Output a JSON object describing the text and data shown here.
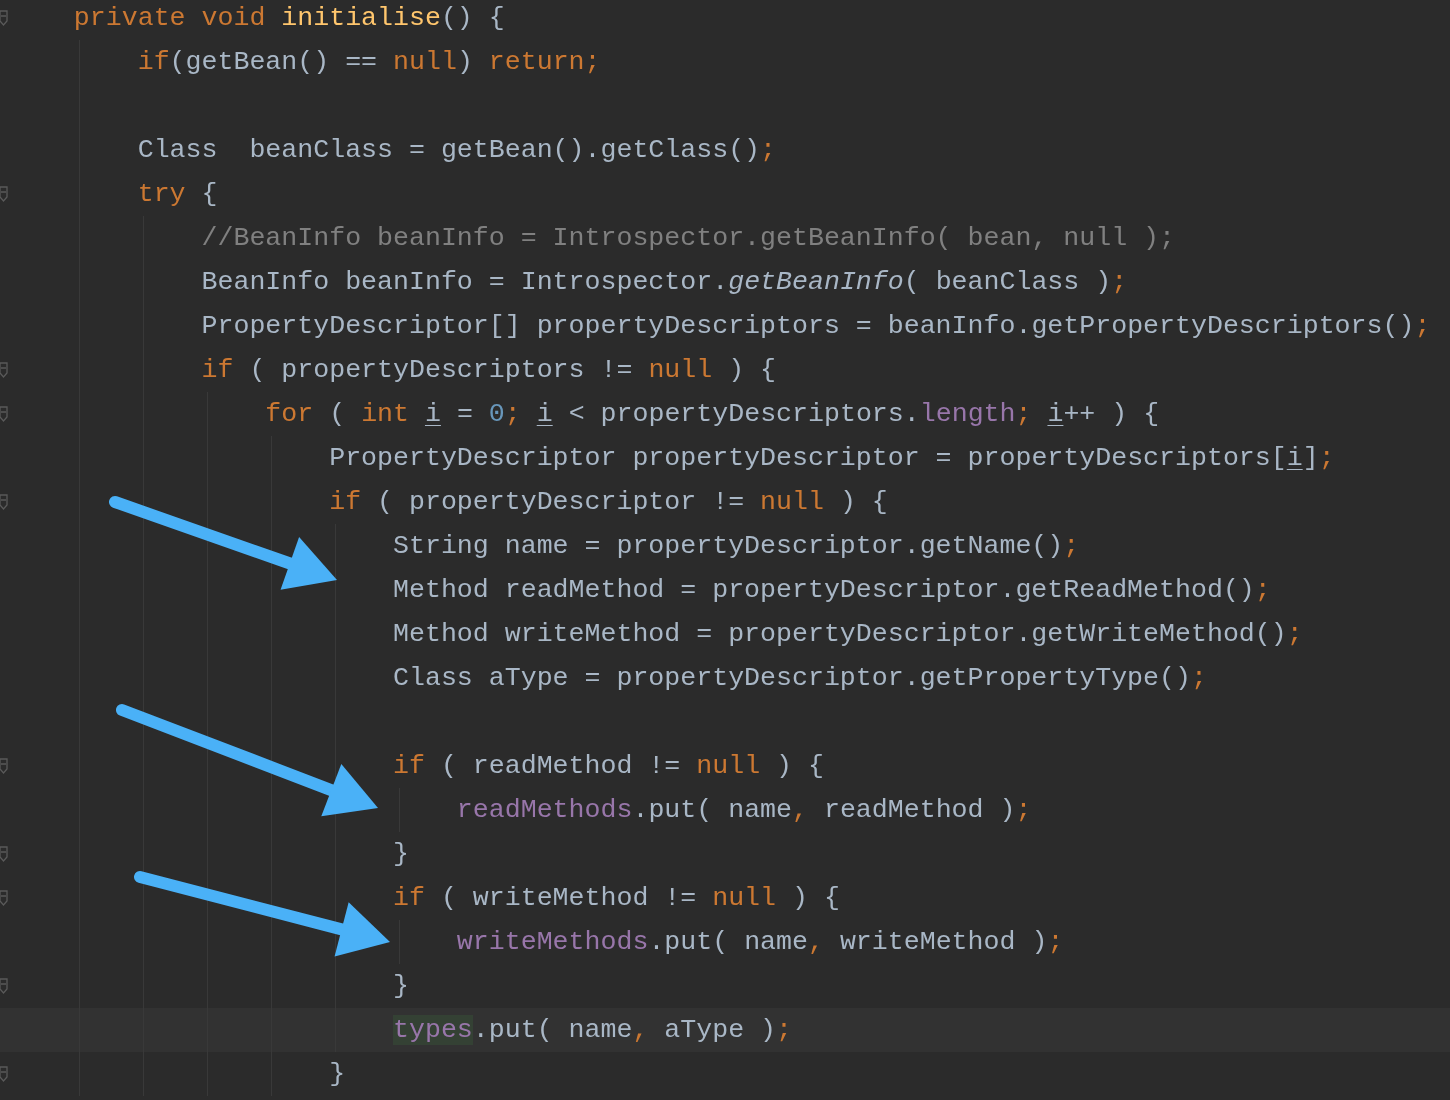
{
  "editor": {
    "lines": [
      {
        "fold": true,
        "current": false,
        "tokens": [
          {
            "kind": "keyword",
            "text": "    private void "
          },
          {
            "kind": "declaration",
            "text": "initialise"
          },
          {
            "kind": "plain",
            "text": "() {"
          }
        ]
      },
      {
        "fold": false,
        "current": false,
        "tokens": [
          {
            "kind": "keyword",
            "text": "        if"
          },
          {
            "kind": "plain",
            "text": "(getBean() == "
          },
          {
            "kind": "keyword",
            "text": "null"
          },
          {
            "kind": "plain",
            "text": ") "
          },
          {
            "kind": "keyword",
            "text": "return;"
          }
        ]
      },
      {
        "fold": false,
        "current": false,
        "space_before": true,
        "tokens": [
          {
            "kind": "plain",
            "text": "        Class  beanClass = getBean().getClass()"
          },
          {
            "kind": "keyword",
            "text": ";"
          }
        ]
      },
      {
        "fold": true,
        "current": false,
        "tokens": [
          {
            "kind": "keyword",
            "text": "        try"
          },
          {
            "kind": "plain",
            "text": " {"
          }
        ]
      },
      {
        "fold": false,
        "current": false,
        "tokens": [
          {
            "kind": "comment",
            "text": "            //BeanInfo beanInfo = Introspector.getBeanInfo( bean, null );"
          }
        ]
      },
      {
        "fold": false,
        "current": false,
        "tokens": [
          {
            "kind": "plain",
            "text": "            BeanInfo beanInfo = Introspector."
          },
          {
            "kind": "static",
            "text": "getBeanInfo"
          },
          {
            "kind": "plain",
            "text": "( beanClass )"
          },
          {
            "kind": "keyword",
            "text": ";"
          }
        ]
      },
      {
        "fold": false,
        "current": false,
        "tokens": [
          {
            "kind": "plain",
            "text": "            PropertyDescriptor[] propertyDescriptors = beanInfo.getPropertyDescriptors()"
          },
          {
            "kind": "keyword",
            "text": ";"
          }
        ]
      },
      {
        "fold": true,
        "current": false,
        "tokens": [
          {
            "kind": "keyword",
            "text": "            if"
          },
          {
            "kind": "plain",
            "text": " ( propertyDescriptors != "
          },
          {
            "kind": "keyword",
            "text": "null"
          },
          {
            "kind": "plain",
            "text": " ) {"
          }
        ]
      },
      {
        "fold": true,
        "current": false,
        "tokens": [
          {
            "kind": "keyword",
            "text": "                for"
          },
          {
            "kind": "plain",
            "text": " ( "
          },
          {
            "kind": "keyword",
            "text": "int "
          },
          {
            "kind": "reassigned",
            "text": "i"
          },
          {
            "kind": "plain",
            "text": " = "
          },
          {
            "kind": "number",
            "text": "0"
          },
          {
            "kind": "keyword",
            "text": "; "
          },
          {
            "kind": "reassigned",
            "text": "i"
          },
          {
            "kind": "plain",
            "text": " < propertyDescriptors."
          },
          {
            "kind": "field",
            "text": "length"
          },
          {
            "kind": "keyword",
            "text": "; "
          },
          {
            "kind": "reassigned",
            "text": "i"
          },
          {
            "kind": "plain",
            "text": "++ ) {"
          }
        ]
      },
      {
        "fold": false,
        "current": false,
        "tokens": [
          {
            "kind": "plain",
            "text": "                    PropertyDescriptor propertyDescriptor = propertyDescriptors["
          },
          {
            "kind": "reassigned",
            "text": "i"
          },
          {
            "kind": "plain",
            "text": "]"
          },
          {
            "kind": "keyword",
            "text": ";"
          }
        ]
      },
      {
        "fold": true,
        "current": false,
        "tokens": [
          {
            "kind": "keyword",
            "text": "                    if"
          },
          {
            "kind": "plain",
            "text": " ( propertyDescriptor != "
          },
          {
            "kind": "keyword",
            "text": "null"
          },
          {
            "kind": "plain",
            "text": " ) {"
          }
        ]
      },
      {
        "fold": false,
        "current": false,
        "tokens": [
          {
            "kind": "plain",
            "text": "                        String name = propertyDescriptor.getName()"
          },
          {
            "kind": "keyword",
            "text": ";"
          }
        ]
      },
      {
        "fold": false,
        "current": false,
        "tokens": [
          {
            "kind": "plain",
            "text": "                        Method readMethod = propertyDescriptor.getReadMethod()"
          },
          {
            "kind": "keyword",
            "text": ";"
          }
        ]
      },
      {
        "fold": false,
        "current": false,
        "tokens": [
          {
            "kind": "plain",
            "text": "                        Method writeMethod = propertyDescriptor.getWriteMethod()"
          },
          {
            "kind": "keyword",
            "text": ";"
          }
        ]
      },
      {
        "fold": false,
        "current": false,
        "tokens": [
          {
            "kind": "plain",
            "text": "                        Class aType = propertyDescriptor.getPropertyType()"
          },
          {
            "kind": "keyword",
            "text": ";"
          }
        ]
      },
      {
        "fold": true,
        "current": false,
        "space_before": true,
        "tokens": [
          {
            "kind": "keyword",
            "text": "                        if"
          },
          {
            "kind": "plain",
            "text": " ( readMethod != "
          },
          {
            "kind": "keyword",
            "text": "null"
          },
          {
            "kind": "plain",
            "text": " ) {"
          }
        ]
      },
      {
        "fold": false,
        "current": false,
        "tokens": [
          {
            "kind": "field",
            "text": "                            readMethods"
          },
          {
            "kind": "plain",
            "text": ".put( name"
          },
          {
            "kind": "keyword",
            "text": ","
          },
          {
            "kind": "plain",
            "text": " readMethod )"
          },
          {
            "kind": "keyword",
            "text": ";"
          }
        ]
      },
      {
        "fold": true,
        "current": false,
        "tokens": [
          {
            "kind": "plain",
            "text": "                        }"
          }
        ]
      },
      {
        "fold": true,
        "current": false,
        "tokens": [
          {
            "kind": "keyword",
            "text": "                        if"
          },
          {
            "kind": "plain",
            "text": " ( writeMethod != "
          },
          {
            "kind": "keyword",
            "text": "null"
          },
          {
            "kind": "plain",
            "text": " ) {"
          }
        ]
      },
      {
        "fold": false,
        "current": false,
        "tokens": [
          {
            "kind": "field",
            "text": "                            writeMethods"
          },
          {
            "kind": "plain",
            "text": ".put( name"
          },
          {
            "kind": "keyword",
            "text": ","
          },
          {
            "kind": "plain",
            "text": " writeMethod )"
          },
          {
            "kind": "keyword",
            "text": ";"
          }
        ]
      },
      {
        "fold": true,
        "current": false,
        "tokens": [
          {
            "kind": "plain",
            "text": "                        }"
          }
        ]
      },
      {
        "fold": false,
        "current": true,
        "tokens": [
          {
            "kind": "field",
            "text": "                        types",
            "highlighted": true
          },
          {
            "kind": "plain",
            "text": ".put( name"
          },
          {
            "kind": "keyword",
            "text": ","
          },
          {
            "kind": "plain",
            "text": " aType )"
          },
          {
            "kind": "keyword",
            "text": ";"
          }
        ]
      },
      {
        "fold": true,
        "current": false,
        "tokens": [
          {
            "kind": "plain",
            "text": "                    }"
          }
        ]
      }
    ]
  }
}
